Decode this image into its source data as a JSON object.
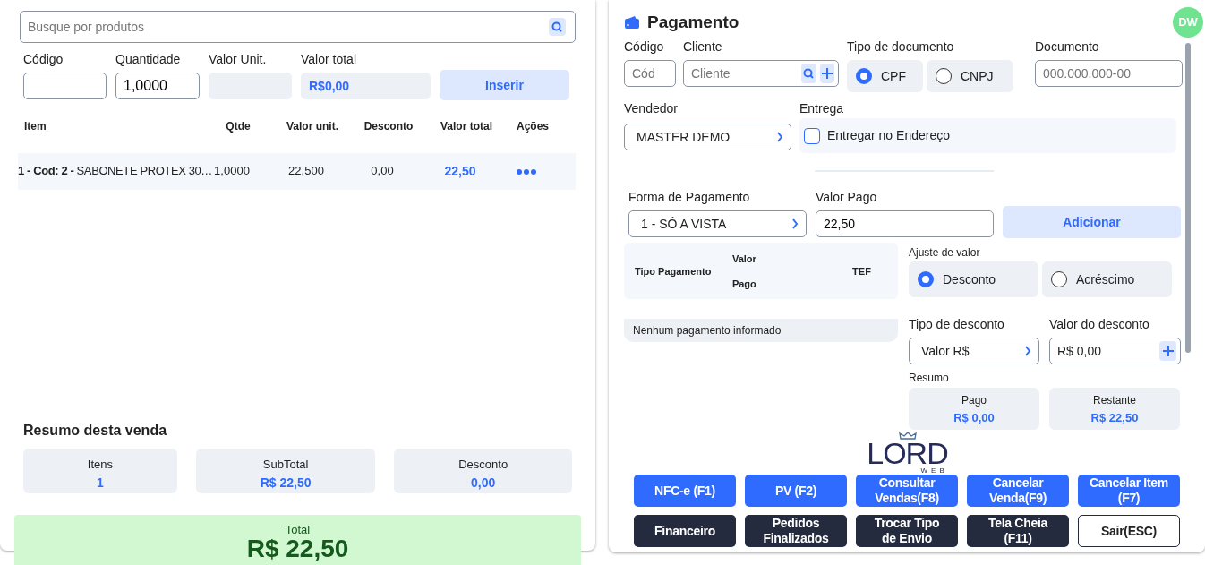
{
  "product_search": {
    "placeholder": "Busque por produtos"
  },
  "entry": {
    "fields": [
      {
        "label": "Código",
        "kind": "input"
      },
      {
        "label": "Quantidade",
        "kind": "input",
        "value": "1,0000"
      },
      {
        "label": "Valor Unit.",
        "kind": "readonly"
      },
      {
        "label": "Valor total",
        "kind": "readonly",
        "value": "R$0,00"
      }
    ],
    "button": "Inserir"
  },
  "items_table": {
    "columns": [
      "Item",
      "Qtde",
      "Valor unit.",
      "Desconto",
      "Valor total",
      "Ações"
    ],
    "rows": [
      {
        "item": "**1 - Cod: 2 -** SABONETE PROTEX 30…",
        "qtde": "1,0000",
        "valor_unit": "22,500",
        "desconto": "0,00",
        "valor_total": "22,50"
      }
    ]
  },
  "sale_summary": {
    "title": "Resumo desta venda",
    "stats": [
      {
        "label": "Itens",
        "value": "1"
      },
      {
        "label": "SubTotal",
        "value": "R$ 22,50"
      },
      {
        "label": "Desconto",
        "value": "0,00"
      }
    ],
    "total": {
      "label": "Total",
      "value": "R$ 22,50"
    }
  },
  "payment": {
    "title": "Pagamento",
    "avatar": "DW",
    "codigo": {
      "label": "Código",
      "placeholder": "Cód"
    },
    "cliente": {
      "label": "Cliente",
      "placeholder": "Cliente"
    },
    "document_type": {
      "label": "Tipo de documento",
      "options": [
        {
          "label": "CPF",
          "selected": true
        },
        {
          "label": "CNPJ",
          "selected": false
        }
      ]
    },
    "documento": {
      "label": "Documento",
      "placeholder": "000.000.000-00"
    },
    "vendedor": {
      "label": "Vendedor",
      "value": "MASTER DEMO"
    },
    "entrega": {
      "label": "Entrega",
      "option": "Entregar no Endereço",
      "checked": false
    },
    "forma_pagamento": {
      "label": "Forma de Pagamento",
      "value": "1 - SÓ A VISTA"
    },
    "valor_pago": {
      "label": "Valor Pago",
      "value": "22,50"
    },
    "add_button": "Adicionar",
    "payments_table": {
      "columns": [
        "Tipo Pagamento",
        "Valor Pago",
        "TEF"
      ],
      "empty_message": "Nenhum pagamento informado"
    },
    "adjustment": {
      "label": "Ajuste de valor",
      "options": [
        {
          "label": "Desconto",
          "selected": true
        },
        {
          "label": "Acréscimo",
          "selected": false
        }
      ]
    },
    "discount_type": {
      "label": "Tipo de desconto",
      "value": "Valor R$"
    },
    "discount_value": {
      "label": "Valor do desconto",
      "value": "R$ 0,00"
    },
    "resumo": {
      "label": "Resumo",
      "stats": [
        {
          "label": "Pago",
          "value": "R$ 0,00"
        },
        {
          "label": "Restante",
          "value": "R$ 22,50"
        }
      ]
    }
  },
  "logo": {
    "text": "LORD",
    "subtext": "WEB"
  },
  "actions": [
    {
      "label": "NFC-e (F1)",
      "kind": "primary"
    },
    {
      "label": "PV (F2)",
      "kind": "primary"
    },
    {
      "label": "Consultar Vendas(F8)",
      "kind": "primary"
    },
    {
      "label": "Cancelar Venda(F9)",
      "kind": "primary"
    },
    {
      "label": "Cancelar Item (F7)",
      "kind": "primary"
    },
    {
      "label": "Financeiro",
      "kind": "dark"
    },
    {
      "label": "Pedidos Finalizados",
      "kind": "dark"
    },
    {
      "label": "Trocar Tipo de Envio",
      "kind": "dark"
    },
    {
      "label": "Tela Cheia (F11)",
      "kind": "dark"
    },
    {
      "label": "Sair(ESC)",
      "kind": "outline"
    }
  ]
}
